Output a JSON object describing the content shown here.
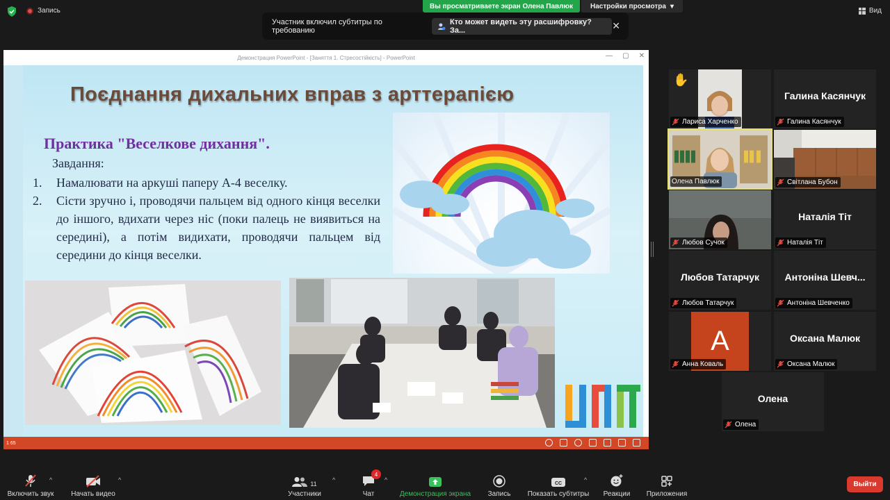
{
  "top": {
    "record_label": "Запись",
    "share_banner": "Вы просматриваете экран Олена Павлюк",
    "view_options": "Настройки просмотра",
    "view_button": "Вид"
  },
  "captions": {
    "notice": "Участник включил субтитры по требованию",
    "who_sees": "Кто может видеть эту расшифровку? За..."
  },
  "ppt": {
    "window_title": "Демонстрация PowerPoint - [Заняття 1. Стресостійкість] - PowerPoint",
    "status_text": "1 65",
    "slide": {
      "title": "Поєднання дихальних вправ з арттерапією",
      "practice": "Практика \"Веселкове дихання\".",
      "task_heading": "Завдання:",
      "steps": [
        {
          "num": "1.",
          "text": "Намалювати на аркуші паперу А-4 веселку."
        },
        {
          "num": "2.",
          "text": "Сісти зручно і, проводячи пальцем від одного кінця веселки до іншого, вдихати через ніс (поки палець не виявиться на середині), а потім видихати, проводячи пальцем від середини до кінця веселки."
        }
      ]
    }
  },
  "participants": [
    {
      "label": "Лариса Харченко",
      "display": "",
      "raised_hand": true
    },
    {
      "label": "Галина Касянчук",
      "display": "Галина Касянчук"
    },
    {
      "label": "Олена Павлюк",
      "display": "",
      "active_speaker": true
    },
    {
      "label": "Світлана Бубон",
      "display": ""
    },
    {
      "label": "Любов Сучок",
      "display": ""
    },
    {
      "label": "Наталія Тіт",
      "display": "Наталія Тіт"
    },
    {
      "label": "Любов Татарчук",
      "display": "Любов Татарчук"
    },
    {
      "label": "Антоніна Шевченко",
      "display": "Антоніна Шевч..."
    },
    {
      "label": "Анна Коваль",
      "display": "",
      "avatar_letter": "A",
      "avatar_color": "#c5431d"
    },
    {
      "label": "Оксана Малюк",
      "display": "Оксана Малюк"
    },
    {
      "label": "Олена",
      "display": "Олена"
    }
  ],
  "toolbar": {
    "mute": "Включить звук",
    "video": "Начать видео",
    "participants": "Участники",
    "participants_count": "11",
    "chat": "Чат",
    "chat_badge": "4",
    "share": "Демонстрация экрана",
    "record": "Запись",
    "captions": "Показать субтитры",
    "reactions": "Реакции",
    "apps": "Приложения",
    "leave": "Выйти"
  }
}
